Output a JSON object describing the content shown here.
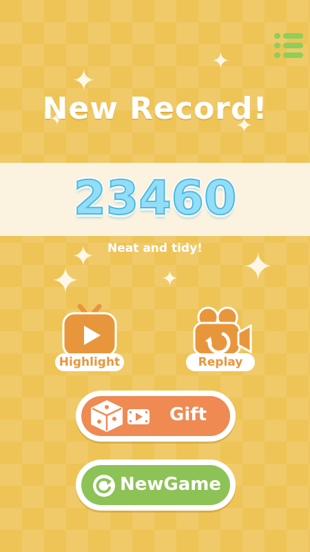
{
  "menu": {
    "icon": "menu-list-icon"
  },
  "header": {
    "title": "New Record!"
  },
  "score": {
    "value": "23460",
    "comment": "Neat and tidy!"
  },
  "actions": [
    {
      "label": "Highlight",
      "icon": "tv-play-icon"
    },
    {
      "label": "Replay",
      "icon": "video-camera-icon"
    }
  ],
  "buttons": {
    "gift": {
      "label": "Gift",
      "icons": [
        "dice-icon",
        "video-icon"
      ]
    },
    "new_game": {
      "label": "NewGame",
      "icon": "restart-icon"
    }
  },
  "colors": {
    "background": "#eec457",
    "band": "#fbf2df",
    "score": "#93ddf6",
    "accent_orange": "#e8963c",
    "gift": "#ee8a52",
    "new_game": "#8dc257",
    "menu": "#8ccf5a"
  }
}
